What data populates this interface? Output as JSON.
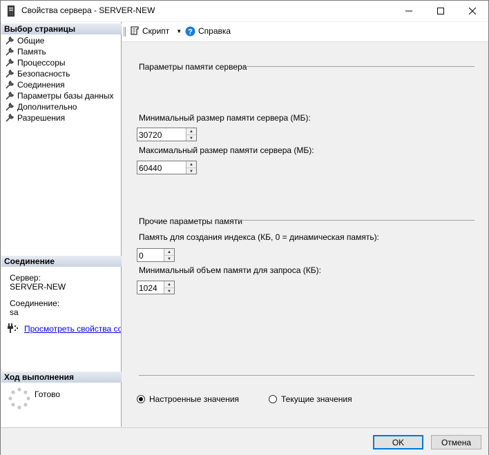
{
  "window": {
    "title": "Свойства сервера - SERVER-NEW"
  },
  "left": {
    "select_page_header": "Выбор страницы",
    "pages": [
      {
        "label": "Общие"
      },
      {
        "label": "Память"
      },
      {
        "label": "Процессоры"
      },
      {
        "label": "Безопасность"
      },
      {
        "label": "Соединения"
      },
      {
        "label": "Параметры базы данных"
      },
      {
        "label": "Дополнительно"
      },
      {
        "label": "Разрешения"
      }
    ],
    "connection_header": "Соединение",
    "server_label": "Сервер:",
    "server_value": "SERVER-NEW",
    "connection_label": "Соединение:",
    "connection_value": "sa",
    "view_props_link": "Просмотреть свойства соединения",
    "progress_header": "Ход выполнения",
    "progress_status": "Готово"
  },
  "toolbar": {
    "script_label": "Скрипт",
    "help_label": "Справка"
  },
  "main": {
    "server_memory_group": "Параметры памяти сервера",
    "min_label": "Минимальный размер памяти сервера (МБ):",
    "min_value": "30720",
    "max_label": "Максимальный размер памяти сервера (МБ):",
    "max_value": "60440",
    "other_group": "Прочие параметры памяти",
    "index_label": "Память для создания индекса (КБ, 0 = динамическая память):",
    "index_value": "0",
    "query_label": "Минимальный объем памяти для запроса (КБ):",
    "query_value": "1024",
    "radio_configured": "Настроенные значения",
    "radio_running": "Текущие значения",
    "selected_radio": "configured"
  },
  "buttons": {
    "ok": "OK",
    "cancel": "Отмена"
  }
}
